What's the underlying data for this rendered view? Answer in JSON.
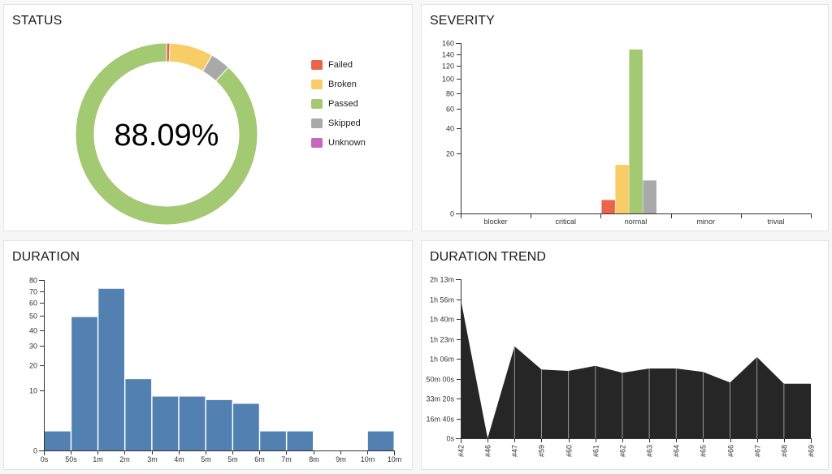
{
  "colors": {
    "failed": "#e9644b",
    "broken": "#f8cd67",
    "passed": "#a3c972",
    "skipped": "#a9a9a9",
    "unknown": "#c866bd",
    "duration_bar": "#5280b1",
    "trend_area": "#262626"
  },
  "status": {
    "title": "STATUS",
    "center_label": "88.09%",
    "legend": [
      {
        "key": "failed",
        "label": "Failed"
      },
      {
        "key": "broken",
        "label": "Broken"
      },
      {
        "key": "passed",
        "label": "Passed"
      },
      {
        "key": "skipped",
        "label": "Skipped"
      },
      {
        "key": "unknown",
        "label": "Unknown"
      }
    ]
  },
  "severity": {
    "title": "SEVERITY"
  },
  "duration": {
    "title": "DURATION"
  },
  "trend": {
    "title": "DURATION TREND"
  },
  "chart_data": [
    {
      "id": "status",
      "type": "pie",
      "title": "STATUS",
      "donut": true,
      "center_text": "88.09%",
      "slice_order": [
        "failed",
        "broken",
        "skipped",
        "passed",
        "unknown"
      ],
      "slices": [
        {
          "name": "Failed",
          "key": "failed",
          "value": 1
        },
        {
          "name": "Broken",
          "key": "broken",
          "value": 13
        },
        {
          "name": "Skipped",
          "key": "skipped",
          "value": 6
        },
        {
          "name": "Passed",
          "key": "passed",
          "value": 148
        },
        {
          "name": "Unknown",
          "key": "unknown",
          "value": 0
        }
      ],
      "legend_position": "right"
    },
    {
      "id": "severity",
      "type": "bar",
      "title": "SEVERITY",
      "y_scale": "sqrt",
      "ylim": [
        0,
        160
      ],
      "yticks": [
        0,
        20,
        40,
        60,
        80,
        100,
        120,
        140,
        160
      ],
      "categories": [
        "blocker",
        "critical",
        "normal",
        "minor",
        "trivial"
      ],
      "series": [
        {
          "name": "Failed",
          "key": "failed",
          "values": [
            0,
            0,
            1,
            0,
            0
          ]
        },
        {
          "name": "Broken",
          "key": "broken",
          "values": [
            0,
            0,
            13,
            0,
            0
          ]
        },
        {
          "name": "Passed",
          "key": "passed",
          "values": [
            0,
            0,
            148,
            0,
            0
          ]
        },
        {
          "name": "Skipped",
          "key": "skipped",
          "values": [
            0,
            0,
            6,
            0,
            0
          ]
        },
        {
          "name": "Unknown",
          "key": "unknown",
          "values": [
            0,
            0,
            0,
            0,
            0
          ]
        }
      ],
      "xlabel": "",
      "ylabel": ""
    },
    {
      "id": "duration",
      "type": "bar",
      "title": "DURATION",
      "y_scale": "sqrt",
      "ylim": [
        0,
        80
      ],
      "yticks": [
        0,
        10,
        20,
        30,
        40,
        50,
        60,
        70,
        80
      ],
      "xtick_labels": [
        "0s",
        "50s",
        "1m",
        "2m",
        "3m",
        "4m",
        "5m",
        "5m",
        "6m",
        "7m",
        "8m",
        "9m",
        "10m",
        "10m"
      ],
      "values": [
        1,
        49,
        72,
        14,
        8,
        8,
        7,
        6,
        1,
        1,
        0,
        0,
        1
      ],
      "xlabel": "",
      "ylabel": ""
    },
    {
      "id": "trend",
      "type": "area",
      "title": "DURATION TREND",
      "y_unit": "seconds",
      "ylim": [
        0,
        8000
      ],
      "yticks": [
        {
          "value": 0,
          "label": "0s"
        },
        {
          "value": 1000,
          "label": "16m 40s"
        },
        {
          "value": 2000,
          "label": "33m 20s"
        },
        {
          "value": 3000,
          "label": "50m 00s"
        },
        {
          "value": 4000,
          "label": "1h 06m"
        },
        {
          "value": 5000,
          "label": "1h 23m"
        },
        {
          "value": 6000,
          "label": "1h 40m"
        },
        {
          "value": 7000,
          "label": "1h 56m"
        },
        {
          "value": 8000,
          "label": "2h 13m"
        }
      ],
      "x": [
        "#42",
        "#46",
        "#47",
        "#59",
        "#60",
        "#61",
        "#62",
        "#63",
        "#64",
        "#65",
        "#66",
        "#67",
        "#68",
        "#69"
      ],
      "values": [
        7000,
        0,
        4624,
        3457,
        3388,
        3645,
        3294,
        3510,
        3510,
        3335,
        2804,
        4082,
        2747,
        2747
      ],
      "xlabel": "",
      "ylabel": ""
    }
  ]
}
